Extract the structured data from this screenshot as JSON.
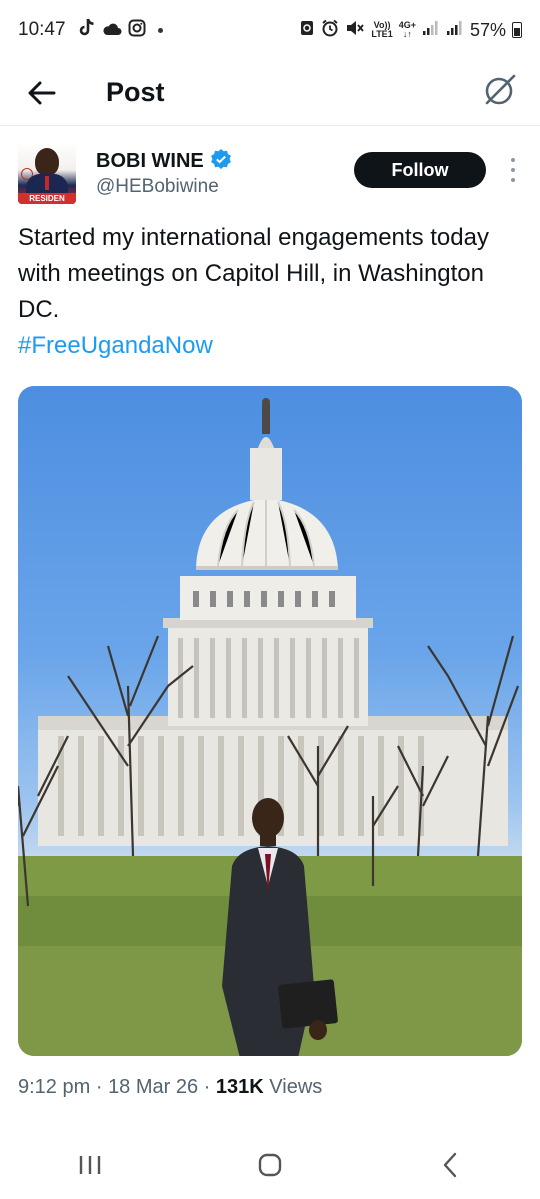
{
  "status_bar": {
    "time": "10:47",
    "left_icons": [
      "tiktok-icon",
      "cloud-icon",
      "instagram-icon"
    ],
    "net_top": "Vo))",
    "net_bottom": "LTE1",
    "net2_top": "4G+",
    "battery": "57%"
  },
  "header": {
    "title": "Post"
  },
  "author": {
    "name": "BOBI WINE",
    "handle": "@HEBobiwine",
    "verified": true,
    "avatar_banner": "RESIDEN",
    "follow_label": "Follow"
  },
  "tweet": {
    "text": "Started my international engagements today with meetings on Capitol Hill, in Washington DC.",
    "hashtag": "#FreeUgandaNow"
  },
  "meta": {
    "time": "9:12 pm",
    "sep1": "·",
    "date": "18 Mar 26",
    "sep2": "·",
    "views_count": "131K",
    "views_label": "Views"
  },
  "colors": {
    "accent": "#1d9bf0",
    "text": "#0f1419",
    "secondary": "#536471",
    "follow_bg": "#0f1419"
  }
}
